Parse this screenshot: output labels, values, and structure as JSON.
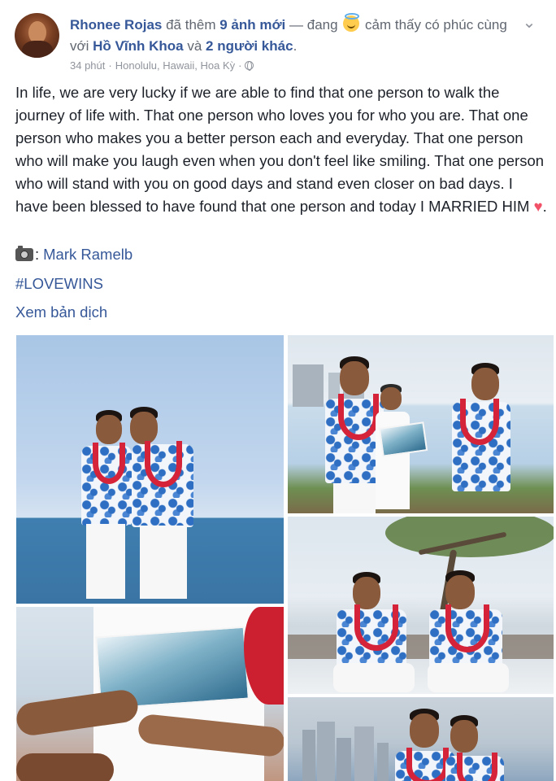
{
  "header": {
    "author": "Rhonee Rojas",
    "action_text": " đã thêm ",
    "photo_count": "9 ảnh mới",
    "feeling_prefix": " — đang ",
    "feeling_text": " cảm thấy có phúc cùng với ",
    "tagged_person": "Hồ Vĩnh Khoa",
    "and_text": " và ",
    "others_link": "2 người khác",
    "end_punct": ".",
    "more_icon": "chevron-down-icon"
  },
  "meta": {
    "time": "34 phút",
    "separator": "·",
    "location": "Honolulu, Hawaii, Hoa Kỳ",
    "separator2": "·",
    "privacy_icon": "globe-icon"
  },
  "post": {
    "body": "In life, we are very lucky if we are able to find that one person to walk the journey of life with. That one person who loves you for who you are. That one person who makes you a better person each and everyday. That one person who will make you laugh even when you don't feel like smiling. That one person who will stand with you on good days and stand even closer on bad days. I have been blessed to have found that one person and today I MARRIED HIM ",
    "body_end": ".",
    "heart": "♥",
    "camera_colon": ":",
    "photographer": "Mark Ramelb",
    "hashtag": "#LOVEWINS",
    "translate": "Xem bản dịch"
  },
  "photos": {
    "count": 5,
    "overflow_text": ""
  }
}
